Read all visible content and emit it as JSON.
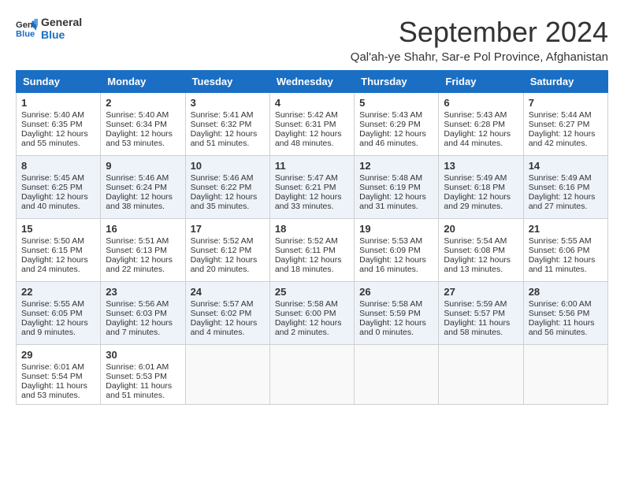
{
  "logo": {
    "line1": "General",
    "line2": "Blue"
  },
  "title": "September 2024",
  "subtitle": "Qal'ah-ye Shahr, Sar-e Pol Province, Afghanistan",
  "days_of_week": [
    "Sunday",
    "Monday",
    "Tuesday",
    "Wednesday",
    "Thursday",
    "Friday",
    "Saturday"
  ],
  "weeks": [
    [
      {
        "day": "1",
        "sunrise": "Sunrise: 5:40 AM",
        "sunset": "Sunset: 6:35 PM",
        "daylight": "Daylight: 12 hours and 55 minutes."
      },
      {
        "day": "2",
        "sunrise": "Sunrise: 5:40 AM",
        "sunset": "Sunset: 6:34 PM",
        "daylight": "Daylight: 12 hours and 53 minutes."
      },
      {
        "day": "3",
        "sunrise": "Sunrise: 5:41 AM",
        "sunset": "Sunset: 6:32 PM",
        "daylight": "Daylight: 12 hours and 51 minutes."
      },
      {
        "day": "4",
        "sunrise": "Sunrise: 5:42 AM",
        "sunset": "Sunset: 6:31 PM",
        "daylight": "Daylight: 12 hours and 48 minutes."
      },
      {
        "day": "5",
        "sunrise": "Sunrise: 5:43 AM",
        "sunset": "Sunset: 6:29 PM",
        "daylight": "Daylight: 12 hours and 46 minutes."
      },
      {
        "day": "6",
        "sunrise": "Sunrise: 5:43 AM",
        "sunset": "Sunset: 6:28 PM",
        "daylight": "Daylight: 12 hours and 44 minutes."
      },
      {
        "day": "7",
        "sunrise": "Sunrise: 5:44 AM",
        "sunset": "Sunset: 6:27 PM",
        "daylight": "Daylight: 12 hours and 42 minutes."
      }
    ],
    [
      {
        "day": "8",
        "sunrise": "Sunrise: 5:45 AM",
        "sunset": "Sunset: 6:25 PM",
        "daylight": "Daylight: 12 hours and 40 minutes."
      },
      {
        "day": "9",
        "sunrise": "Sunrise: 5:46 AM",
        "sunset": "Sunset: 6:24 PM",
        "daylight": "Daylight: 12 hours and 38 minutes."
      },
      {
        "day": "10",
        "sunrise": "Sunrise: 5:46 AM",
        "sunset": "Sunset: 6:22 PM",
        "daylight": "Daylight: 12 hours and 35 minutes."
      },
      {
        "day": "11",
        "sunrise": "Sunrise: 5:47 AM",
        "sunset": "Sunset: 6:21 PM",
        "daylight": "Daylight: 12 hours and 33 minutes."
      },
      {
        "day": "12",
        "sunrise": "Sunrise: 5:48 AM",
        "sunset": "Sunset: 6:19 PM",
        "daylight": "Daylight: 12 hours and 31 minutes."
      },
      {
        "day": "13",
        "sunrise": "Sunrise: 5:49 AM",
        "sunset": "Sunset: 6:18 PM",
        "daylight": "Daylight: 12 hours and 29 minutes."
      },
      {
        "day": "14",
        "sunrise": "Sunrise: 5:49 AM",
        "sunset": "Sunset: 6:16 PM",
        "daylight": "Daylight: 12 hours and 27 minutes."
      }
    ],
    [
      {
        "day": "15",
        "sunrise": "Sunrise: 5:50 AM",
        "sunset": "Sunset: 6:15 PM",
        "daylight": "Daylight: 12 hours and 24 minutes."
      },
      {
        "day": "16",
        "sunrise": "Sunrise: 5:51 AM",
        "sunset": "Sunset: 6:13 PM",
        "daylight": "Daylight: 12 hours and 22 minutes."
      },
      {
        "day": "17",
        "sunrise": "Sunrise: 5:52 AM",
        "sunset": "Sunset: 6:12 PM",
        "daylight": "Daylight: 12 hours and 20 minutes."
      },
      {
        "day": "18",
        "sunrise": "Sunrise: 5:52 AM",
        "sunset": "Sunset: 6:11 PM",
        "daylight": "Daylight: 12 hours and 18 minutes."
      },
      {
        "day": "19",
        "sunrise": "Sunrise: 5:53 AM",
        "sunset": "Sunset: 6:09 PM",
        "daylight": "Daylight: 12 hours and 16 minutes."
      },
      {
        "day": "20",
        "sunrise": "Sunrise: 5:54 AM",
        "sunset": "Sunset: 6:08 PM",
        "daylight": "Daylight: 12 hours and 13 minutes."
      },
      {
        "day": "21",
        "sunrise": "Sunrise: 5:55 AM",
        "sunset": "Sunset: 6:06 PM",
        "daylight": "Daylight: 12 hours and 11 minutes."
      }
    ],
    [
      {
        "day": "22",
        "sunrise": "Sunrise: 5:55 AM",
        "sunset": "Sunset: 6:05 PM",
        "daylight": "Daylight: 12 hours and 9 minutes."
      },
      {
        "day": "23",
        "sunrise": "Sunrise: 5:56 AM",
        "sunset": "Sunset: 6:03 PM",
        "daylight": "Daylight: 12 hours and 7 minutes."
      },
      {
        "day": "24",
        "sunrise": "Sunrise: 5:57 AM",
        "sunset": "Sunset: 6:02 PM",
        "daylight": "Daylight: 12 hours and 4 minutes."
      },
      {
        "day": "25",
        "sunrise": "Sunrise: 5:58 AM",
        "sunset": "Sunset: 6:00 PM",
        "daylight": "Daylight: 12 hours and 2 minutes."
      },
      {
        "day": "26",
        "sunrise": "Sunrise: 5:58 AM",
        "sunset": "Sunset: 5:59 PM",
        "daylight": "Daylight: 12 hours and 0 minutes."
      },
      {
        "day": "27",
        "sunrise": "Sunrise: 5:59 AM",
        "sunset": "Sunset: 5:57 PM",
        "daylight": "Daylight: 11 hours and 58 minutes."
      },
      {
        "day": "28",
        "sunrise": "Sunrise: 6:00 AM",
        "sunset": "Sunset: 5:56 PM",
        "daylight": "Daylight: 11 hours and 56 minutes."
      }
    ],
    [
      {
        "day": "29",
        "sunrise": "Sunrise: 6:01 AM",
        "sunset": "Sunset: 5:54 PM",
        "daylight": "Daylight: 11 hours and 53 minutes."
      },
      {
        "day": "30",
        "sunrise": "Sunrise: 6:01 AM",
        "sunset": "Sunset: 5:53 PM",
        "daylight": "Daylight: 11 hours and 51 minutes."
      },
      null,
      null,
      null,
      null,
      null
    ]
  ]
}
